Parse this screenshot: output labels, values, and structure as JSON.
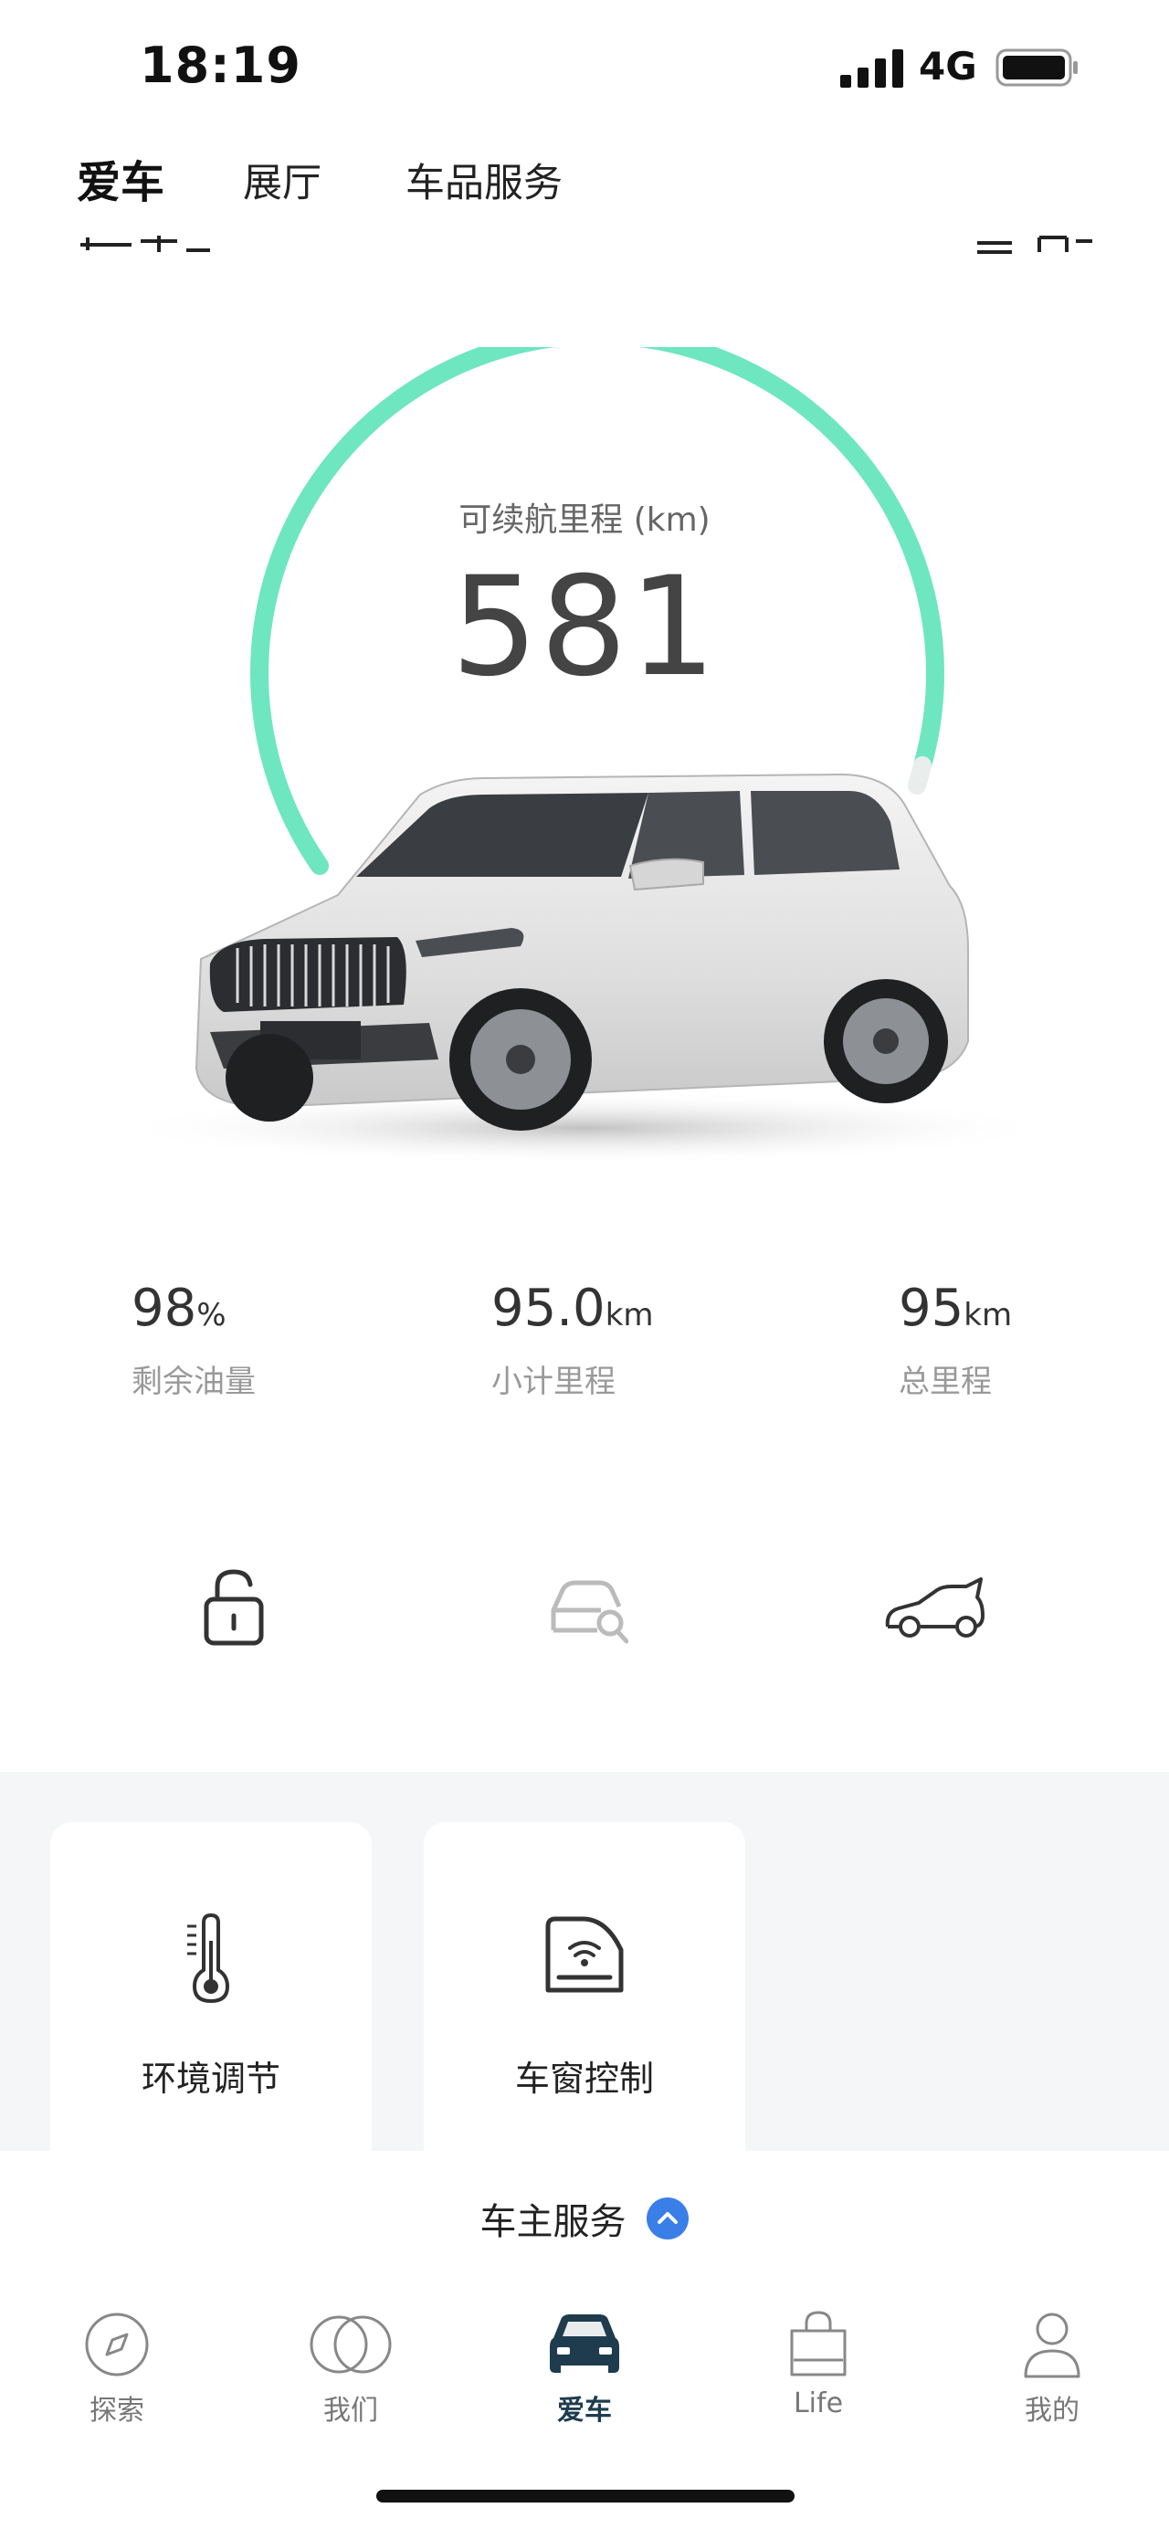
{
  "status_bar": {
    "time": "18:19",
    "network": "4G"
  },
  "top_tabs": [
    {
      "label": "爱车",
      "active": true
    },
    {
      "label": "展厅",
      "active": false
    },
    {
      "label": "车品服务",
      "active": false
    }
  ],
  "range": {
    "label": "可续航里程 (km)",
    "value": "581",
    "gauge_color": "#6ee6bf"
  },
  "stats": [
    {
      "value": "98",
      "unit": "%",
      "label": "剩余油量"
    },
    {
      "value": "95.0",
      "unit": "km",
      "label": "小计里程"
    },
    {
      "value": "95",
      "unit": "km",
      "label": "总里程"
    }
  ],
  "quick_icons": [
    "unlock-icon",
    "car-search-icon",
    "car-trunk-icon"
  ],
  "features": [
    {
      "label": "环境调节",
      "icon": "thermometer-icon"
    },
    {
      "label": "车窗控制",
      "icon": "car-window-icon"
    }
  ],
  "owner_service": {
    "label": "车主服务",
    "accent": "#3a7ee8"
  },
  "bottom_nav": [
    {
      "label": "探索",
      "icon": "compass-icon",
      "active": false
    },
    {
      "label": "我们",
      "icon": "circles-icon",
      "active": false
    },
    {
      "label": "爱车",
      "icon": "car-icon",
      "active": true
    },
    {
      "label": "Life",
      "icon": "shopping-bag-icon",
      "active": false
    },
    {
      "label": "我的",
      "icon": "person-icon",
      "active": false
    }
  ]
}
